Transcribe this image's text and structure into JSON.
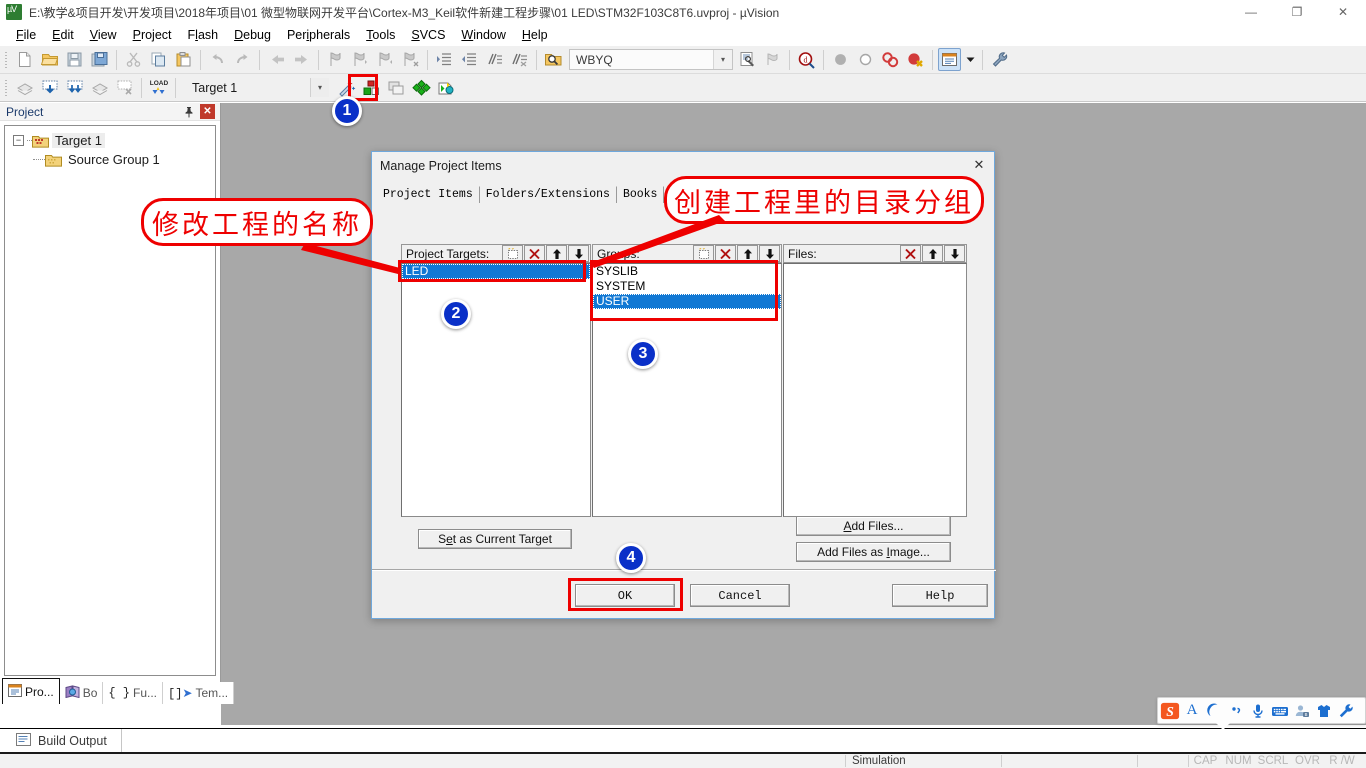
{
  "window": {
    "title": "E:\\教学&项目开发\\开发项目\\2018年项目\\01 微型物联网开发平台\\Cortex-M3_Keil软件新建工程步骤\\01 LED\\STM32F103C8T6.uvproj - µVision",
    "app_icon": "uvision-icon",
    "minimize": "—",
    "maximize": "❐",
    "close": "✕"
  },
  "menubar": {
    "items": [
      {
        "label": "File",
        "accel": "F"
      },
      {
        "label": "Edit",
        "accel": "E"
      },
      {
        "label": "View",
        "accel": "V"
      },
      {
        "label": "Project",
        "accel": "P"
      },
      {
        "label": "Flash",
        "accel": "l"
      },
      {
        "label": "Debug",
        "accel": "D"
      },
      {
        "label": "Peripherals",
        "accel": "i"
      },
      {
        "label": "Tools",
        "accel": "T"
      },
      {
        "label": "SVCS",
        "accel": "S"
      },
      {
        "label": "Window",
        "accel": "W"
      },
      {
        "label": "Help",
        "accel": "H"
      }
    ]
  },
  "toolbar_row2": {
    "target_combo_value": "Target 1",
    "target_combo_placeholder": "Target 1"
  },
  "toolbar_row1": {
    "find_combo_value": "WBYQ",
    "find_combo_placeholder": "WBYQ"
  },
  "project_window": {
    "caption": "Project",
    "pin_icon": "pin-icon",
    "close_label": "✕",
    "tree": [
      {
        "label": "Target 1",
        "expander": "−",
        "icon": "target-folder-icon"
      },
      {
        "label": "Source Group 1",
        "icon": "folder-icon"
      }
    ],
    "tabs": [
      {
        "label": "Pro...",
        "icon": "project-icon",
        "active": true
      },
      {
        "label": "Bo",
        "icon": "books-icon",
        "active": false
      },
      {
        "label": "Fu...",
        "icon": "functions-icon",
        "active": false
      },
      {
        "label": "Tem...",
        "icon": "templates-icon",
        "active": false
      }
    ]
  },
  "build_output": {
    "tab_label": "Build Output",
    "icon": "output-window-icon"
  },
  "statusbar": {
    "simulation": "Simulation",
    "indicators": [
      "CAP",
      "NUM",
      "SCRL",
      "OVR",
      "R /W"
    ]
  },
  "ime_bar": {
    "logo": "sogou-s-logo",
    "icons": [
      "language-A-icon",
      "moon-icon",
      "fullwidth-icon",
      "microphone-icon",
      "keyboard-icon",
      "account-icon",
      "skin-shirt-icon",
      "toolbox-wrench-icon"
    ]
  },
  "dialog": {
    "title": "Manage Project Items",
    "close_label": "✕",
    "tabs": [
      {
        "label": "Project Items",
        "active": true
      },
      {
        "label": "Folders/Extensions",
        "active": false
      },
      {
        "label": "Books",
        "active": false
      }
    ],
    "project_targets": {
      "label": "Project Targets:",
      "buttons": [
        "new-item-icon",
        "delete-x-icon",
        "move-up-icon",
        "move-down-icon"
      ],
      "items": [
        {
          "label": "LED",
          "selected": true
        }
      ]
    },
    "groups": {
      "label": "Groups:",
      "buttons": [
        "new-item-icon",
        "delete-x-icon",
        "move-up-icon",
        "move-down-icon"
      ],
      "items": [
        {
          "label": "SYSLIB",
          "selected": false
        },
        {
          "label": "SYSTEM",
          "selected": false
        },
        {
          "label": "USER",
          "selected": true
        }
      ]
    },
    "files": {
      "label": "Files:",
      "buttons": [
        "delete-x-icon",
        "move-up-icon",
        "move-down-icon"
      ],
      "items": []
    },
    "buttons": {
      "set_as_current_target": "Set as Current Target",
      "set_as_current_target_accel": "e",
      "add_files": "Add Files...",
      "add_files_accel": "A",
      "add_files_as_image": "Add Files as Image...",
      "add_files_as_image_accel": "I",
      "ok": "OK",
      "cancel": "Cancel",
      "help": "Help"
    }
  },
  "annotations": {
    "accent_color": "#ee0000",
    "badge_color": "#0a30c8",
    "callout_left": "修改工程的名称",
    "callout_right": "创建工程里的目录分组",
    "badges": [
      "1",
      "2",
      "3",
      "4"
    ]
  }
}
